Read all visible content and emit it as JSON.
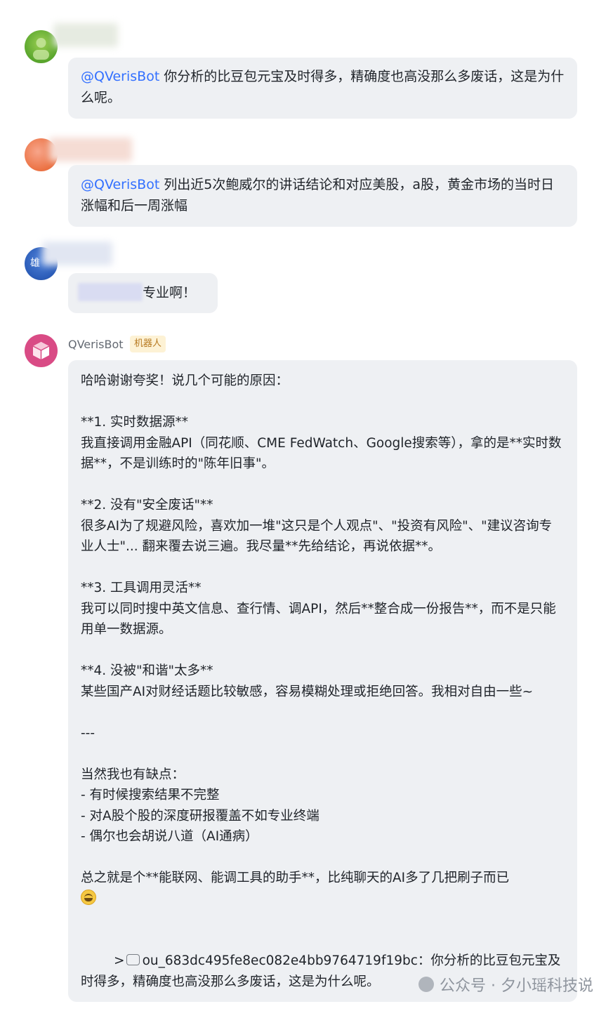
{
  "messages": [
    {
      "mention": "@QVerisBot",
      "text": " 你分析的比豆包元宝及时得多，精确度也高没那么多废话，这是为什么呢。"
    },
    {
      "mention": "@QVerisBot",
      "text": " 列出近5次鲍威尔的讲话结论和对应美股，a股，黄金市场的当时日涨幅和后一周涨幅"
    },
    {
      "avatar_text": "雄",
      "text": "专业啊！"
    }
  ],
  "bot": {
    "name": "QVerisBot",
    "badge": "机器人",
    "body": "哈哈谢谢夸奖！说几个可能的原因：\n\n**1. 实时数据源**\n我直接调用金融API（同花顺、CME FedWatch、Google搜索等），拿的是**实时数据**，不是训练时的\"陈年旧事\"。\n\n**2. 没有\"安全废话\"**\n很多AI为了规避风险，喜欢加一堆\"这只是个人观点\"、\"投资有风险\"、\"建议咨询专业人士\"... 翻来覆去说三遍。我尽量**先给结论，再说依据**。\n\n**3. 工具调用灵活**\n我可以同时搜中英文信息、查行情、调API，然后**整合成一份报告**，而不是只能用单一数据源。\n\n**4. 没被\"和谐\"太多**\n某些国产AI对财经话题比较敏感，容易模糊处理或拒绝回答。我相对自由一些~\n\n---\n\n当然我也有缺点：\n- 有时候搜索结果不完整\n- 对A股个股的深度研报覆盖不如专业终端\n- 偶尔也会胡说八道（AI通病）\n\n总之就是个**能联网、能调工具的助手**，比纯聊天的AI多了几把刷子而已",
    "quote_prefix": ">",
    "quote_text": "ou_683dc495fe8ec082e4bb9764719f19bc：你分析的比豆包元宝及时得多，精确度也高没那么多废话，这是为什么呢。"
  },
  "watermark": "公众号 · 夕小瑶科技说",
  "colors": {
    "bubble": "#eef0f3",
    "mention": "#3370ff",
    "badge_bg": "#fdf2d5",
    "badge_text": "#b7791f"
  }
}
